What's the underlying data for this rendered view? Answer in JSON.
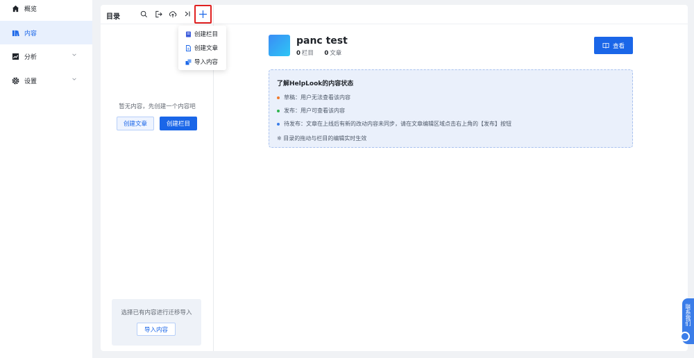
{
  "sidebar": {
    "items": [
      {
        "label": "概览",
        "icon": "home-icon"
      },
      {
        "label": "内容",
        "icon": "content-icon",
        "active": true
      },
      {
        "label": "分析",
        "icon": "analytics-icon"
      },
      {
        "label": "设置",
        "icon": "gear-icon"
      }
    ]
  },
  "tree": {
    "title": "目录",
    "toolbar_icons": [
      "search-icon",
      "export-icon",
      "upload-icon",
      "collapse-icon",
      "plus-icon"
    ],
    "empty_text": "暂无内容，先创建一个内容吧",
    "create_article_label": "创建文章",
    "create_column_label": "创建栏目",
    "import_hint": "选择已有内容进行迁移导入",
    "import_label": "导入内容"
  },
  "dropdown": {
    "items": [
      {
        "label": "创建栏目",
        "icon": "book-icon"
      },
      {
        "label": "创建文章",
        "icon": "document-icon"
      },
      {
        "label": "导入内容",
        "icon": "import-icon"
      }
    ]
  },
  "space": {
    "title": "panc test",
    "column_count": "0",
    "column_label": "栏目",
    "article_count": "0",
    "article_label": "文章",
    "view_label": "查看"
  },
  "info": {
    "title": "了解HelpLook的内容状态",
    "rows": [
      {
        "text": "草稿：用户无法查看该内容",
        "color": "#f07a2c"
      },
      {
        "text": "发布：用户可查看该内容",
        "color": "#2fb44d"
      },
      {
        "text": "待发布：文章在上线后有新的改动内容未同步，请在文章编辑区域点击右上角的【发布】按钮",
        "color": "#3b7de9"
      }
    ],
    "note": "※ 目录的拖动与栏目的编辑实时生效"
  },
  "float_tab": {
    "label": "联系我们"
  },
  "colors": {
    "primary": "#1a66e8",
    "highlight": "#e02020"
  }
}
